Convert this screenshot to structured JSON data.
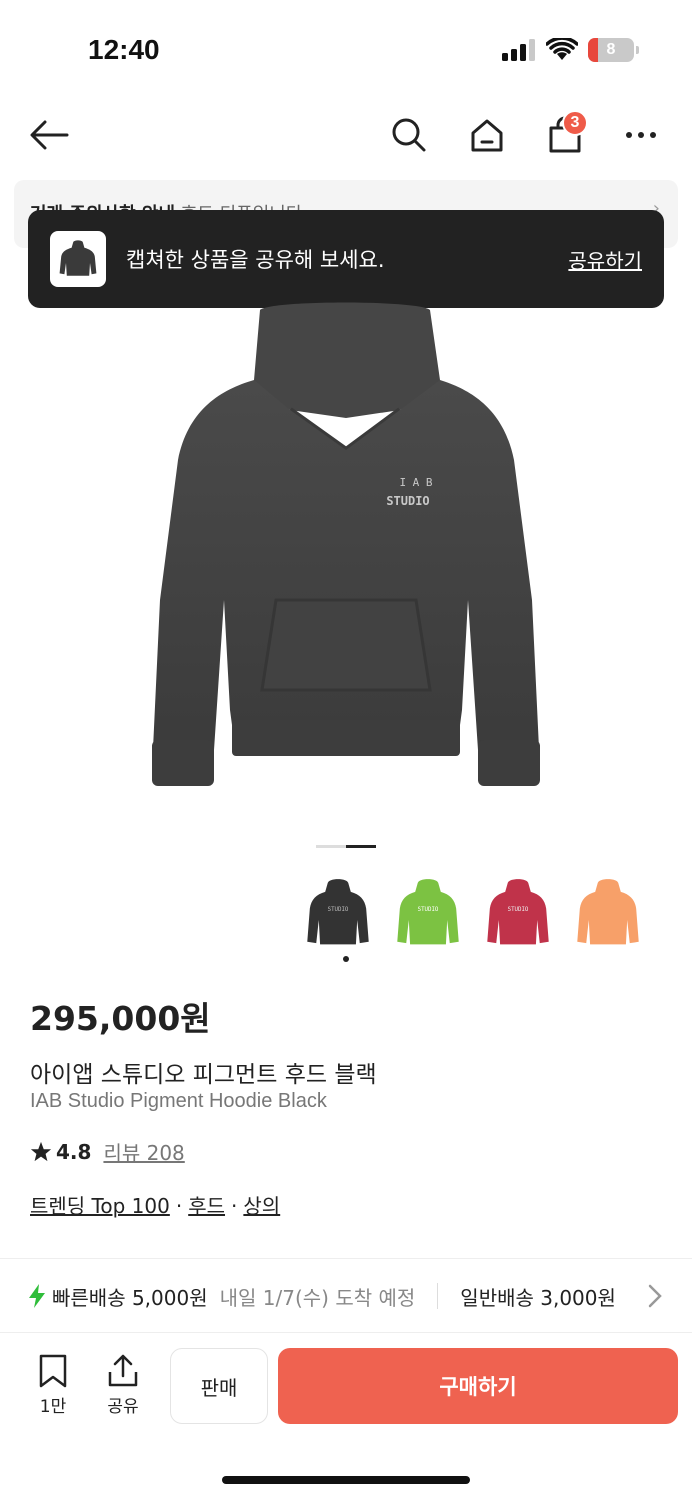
{
  "status": {
    "time": "12:40",
    "battery": "8"
  },
  "nav": {
    "cart_count": "3"
  },
  "notice": {
    "title": "거래 주의사항 안내",
    "text": " 후드 티푸입니다"
  },
  "toast": {
    "message": "캡쳐한 상품을 공유해 보세요.",
    "action": "공유하기"
  },
  "colors": {
    "accent": "#ef6250",
    "badge": "#ef5b49",
    "toast_bg": "#222222",
    "fast_ship": "#2fbd3a"
  },
  "swatches": [
    {
      "color": "#333333",
      "name": "black"
    },
    {
      "color": "#7cc242",
      "name": "green"
    },
    {
      "color": "#c0334a",
      "name": "red"
    },
    {
      "color": "#f7a069",
      "name": "orange"
    }
  ],
  "product": {
    "price": "295,000원",
    "name_ko": "아이앱 스튜디오 피그먼트 후드 블랙",
    "name_en": "IAB Studio Pigment Hoodie Black",
    "rating": "4.8",
    "review_label": "리뷰 208",
    "tags": [
      "트렌딩 Top 100",
      "후드",
      "상의"
    ],
    "tag_sep": "·"
  },
  "shipping": {
    "fast_label": "빠른배송 5,000원",
    "fast_eta": "내일 1/7(수) 도착 예정",
    "normal_label": "일반배송 3,000원"
  },
  "actions": {
    "save_count": "1만",
    "share_label": "공유",
    "sell_label": "판매",
    "buy_label": "구매하기"
  }
}
